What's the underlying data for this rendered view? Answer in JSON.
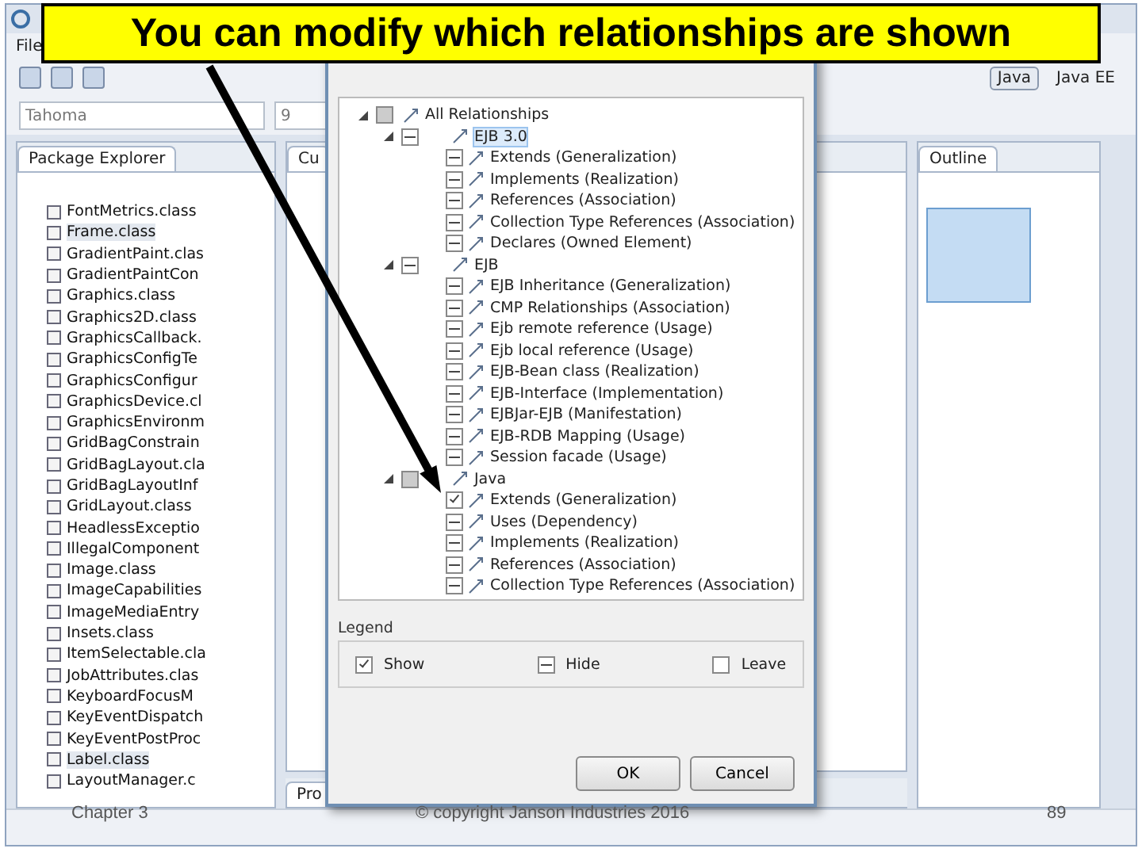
{
  "slide_title": "You can modify which relationships are shown",
  "window": {
    "menu": [
      "File"
    ],
    "font_combo": "Tahoma",
    "size_combo": "9",
    "perspectives": [
      {
        "label": "Java",
        "selected": true
      },
      {
        "label": "Java EE",
        "selected": false
      }
    ]
  },
  "package_explorer": {
    "tab": "Package Explorer",
    "files": [
      {
        "name": "FontMetrics.class",
        "selected": false
      },
      {
        "name": "Frame.class",
        "selected": true
      },
      {
        "name": "GradientPaint.clas",
        "selected": false
      },
      {
        "name": "GradientPaintCon",
        "selected": false
      },
      {
        "name": "Graphics.class",
        "selected": false
      },
      {
        "name": "Graphics2D.class",
        "selected": false
      },
      {
        "name": "GraphicsCallback.",
        "selected": false
      },
      {
        "name": "GraphicsConfigTe",
        "selected": false
      },
      {
        "name": "GraphicsConfigur",
        "selected": false
      },
      {
        "name": "GraphicsDevice.cl",
        "selected": false
      },
      {
        "name": "GraphicsEnvironm",
        "selected": false
      },
      {
        "name": "GridBagConstrain",
        "selected": false
      },
      {
        "name": "GridBagLayout.cla",
        "selected": false
      },
      {
        "name": "GridBagLayoutInf",
        "selected": false
      },
      {
        "name": "GridLayout.class",
        "selected": false
      },
      {
        "name": "HeadlessExceptio",
        "selected": false
      },
      {
        "name": "IllegalComponent",
        "selected": false
      },
      {
        "name": "Image.class",
        "selected": false
      },
      {
        "name": "ImageCapabilities",
        "selected": false
      },
      {
        "name": "ImageMediaEntry",
        "selected": false
      },
      {
        "name": "Insets.class",
        "selected": false
      },
      {
        "name": "ItemSelectable.cla",
        "selected": false
      },
      {
        "name": "JobAttributes.clas",
        "selected": false
      },
      {
        "name": "KeyboardFocusM",
        "selected": false
      },
      {
        "name": "KeyEventDispatch",
        "selected": false
      },
      {
        "name": "KeyEventPostProc",
        "selected": false
      },
      {
        "name": "Label.class",
        "selected": true
      },
      {
        "name": "LayoutManager.c",
        "selected": false
      }
    ]
  },
  "editor_tab": "Cu",
  "bottom_tab": "Pro",
  "outline_tab": "Outline",
  "dialog": {
    "tree": [
      {
        "label": "All Relationships",
        "kind": "partial",
        "expanded": true,
        "children": [
          {
            "label": "EJB 3.0",
            "kind": "hide",
            "expanded": true,
            "selected": true,
            "children": [
              {
                "label": "Extends (Generalization)",
                "kind": "hide"
              },
              {
                "label": "Implements (Realization)",
                "kind": "hide"
              },
              {
                "label": "References (Association)",
                "kind": "hide"
              },
              {
                "label": "Collection Type References (Association)",
                "kind": "hide"
              },
              {
                "label": "Declares (Owned Element)",
                "kind": "hide"
              }
            ]
          },
          {
            "label": "EJB",
            "kind": "hide",
            "expanded": true,
            "selected": false,
            "children": [
              {
                "label": "EJB Inheritance (Generalization)",
                "kind": "hide"
              },
              {
                "label": "CMP Relationships (Association)",
                "kind": "hide"
              },
              {
                "label": "Ejb remote reference (Usage)",
                "kind": "hide"
              },
              {
                "label": "Ejb local reference (Usage)",
                "kind": "hide"
              },
              {
                "label": "EJB-Bean class (Realization)",
                "kind": "hide"
              },
              {
                "label": "EJB-Interface (Implementation)",
                "kind": "hide"
              },
              {
                "label": "EJBJar-EJB (Manifestation)",
                "kind": "hide"
              },
              {
                "label": "EJB-RDB Mapping (Usage)",
                "kind": "hide"
              },
              {
                "label": "Session facade (Usage)",
                "kind": "hide"
              }
            ]
          },
          {
            "label": "Java",
            "kind": "partial",
            "expanded": true,
            "selected": false,
            "children": [
              {
                "label": "Extends (Generalization)",
                "kind": "show"
              },
              {
                "label": "Uses (Dependency)",
                "kind": "hide"
              },
              {
                "label": "Implements (Realization)",
                "kind": "hide"
              },
              {
                "label": "References (Association)",
                "kind": "hide"
              },
              {
                "label": "Collection Type References (Association)",
                "kind": "hide"
              }
            ]
          }
        ]
      }
    ],
    "legend_title": "Legend",
    "legend": [
      {
        "label": "Show",
        "kind": "show"
      },
      {
        "label": "Hide",
        "kind": "hide"
      },
      {
        "label": "Leave",
        "kind": "leave"
      }
    ],
    "buttons": [
      "OK",
      "Cancel"
    ]
  },
  "footer": {
    "chapter": "Chapter 3",
    "copyright": "© copyright Janson Industries 2016",
    "page": "89"
  }
}
